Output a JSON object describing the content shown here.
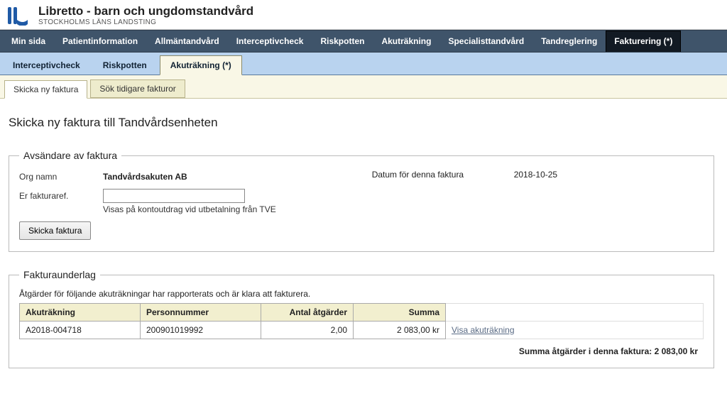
{
  "header": {
    "title": "Libretto - barn och ungdomstandvård",
    "subtitle": "STOCKHOLMS LÄNS LANDSTING"
  },
  "main_nav": {
    "items": [
      {
        "label": "Min sida"
      },
      {
        "label": "Patientinformation"
      },
      {
        "label": "Allmäntandvård"
      },
      {
        "label": "Interceptivcheck"
      },
      {
        "label": "Riskpotten"
      },
      {
        "label": "Akuträkning"
      },
      {
        "label": "Specialisttandvård"
      },
      {
        "label": "Tandreglering"
      },
      {
        "label": "Fakturering (*)"
      }
    ],
    "active_index": 8
  },
  "sub_nav": {
    "items": [
      {
        "label": "Interceptivcheck"
      },
      {
        "label": "Riskpotten"
      },
      {
        "label": "Akuträkning (*)"
      }
    ],
    "active_index": 2
  },
  "tert_nav": {
    "items": [
      {
        "label": "Skicka ny faktura"
      },
      {
        "label": "Sök tidigare fakturor"
      }
    ],
    "active_index": 0
  },
  "page": {
    "heading": "Skicka ny faktura till Tandvårdsenheten",
    "sender_legend": "Avsändare av faktura",
    "org_label": "Org namn",
    "org_value": "Tandvårdsakuten AB",
    "date_label": "Datum för denna faktura",
    "date_value": "2018-10-25",
    "ref_label": "Er fakturaref.",
    "ref_value": "",
    "ref_hint": "Visas på kontoutdrag vid utbetalning från TVE",
    "send_button": "Skicka faktura",
    "underlag_legend": "Fakturaunderlag",
    "underlag_desc": "Åtgärder för följande akuträkningar har rapporterats och är klara att fakturera.",
    "table": {
      "headers": {
        "akut": "Akuträkning",
        "pnr": "Personnummer",
        "antal": "Antal åtgärder",
        "summa": "Summa"
      },
      "rows": [
        {
          "akut": "A2018-004718",
          "pnr": "200901019992",
          "antal": "2,00",
          "summa": "2 083,00 kr",
          "link": "Visa akuträkning"
        }
      ]
    },
    "total_label": "Summa åtgärder i denna faktura:",
    "total_value": "2 083,00 kr"
  }
}
